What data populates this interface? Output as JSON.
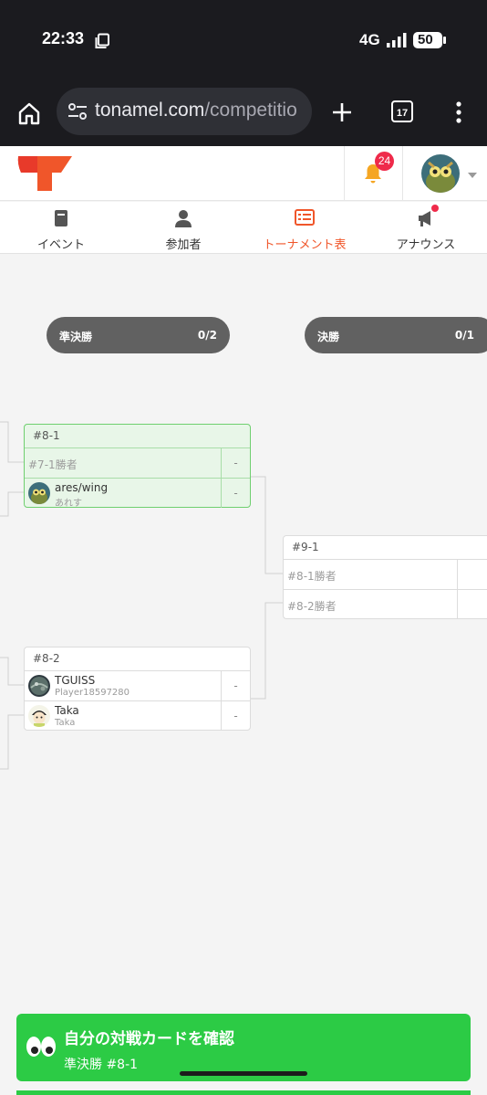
{
  "status_bar": {
    "time": "22:33",
    "network": "4G",
    "battery": "50"
  },
  "browser": {
    "url_host": "tonamel.com",
    "url_path": "/competitio",
    "tab_count": "17"
  },
  "header": {
    "notification_count": "24",
    "accent": "#f0562a"
  },
  "tabs": [
    {
      "label": "イベント",
      "icon": "document-icon"
    },
    {
      "label": "参加者",
      "icon": "person-icon"
    },
    {
      "label": "トーナメント表",
      "icon": "bracket-list-icon",
      "active": true
    },
    {
      "label": "アナウンス",
      "icon": "megaphone-icon"
    }
  ],
  "rounds": [
    {
      "name": "準決勝",
      "progress": "0/2"
    },
    {
      "name": "決勝",
      "progress": "0/1"
    }
  ],
  "matches": {
    "m81": {
      "id": "#8-1",
      "slot1": {
        "label": "#7-1勝者",
        "score": "-"
      },
      "slot2": {
        "name": "ares/wing",
        "sub": "あれす",
        "score": "-"
      }
    },
    "m82": {
      "id": "#8-2",
      "slot1": {
        "name": "TGUISS",
        "sub": "Player18597280",
        "score": "-"
      },
      "slot2": {
        "name": "Taka",
        "sub": "Taka",
        "score": "-"
      }
    },
    "m91": {
      "id": "#9-1",
      "slot1": {
        "label": "#8-1勝者"
      },
      "slot2": {
        "label": "#8-2勝者"
      }
    }
  },
  "my_match_banner": {
    "title": "自分の対戦カードを確認",
    "subtitle": "準決勝 #8-1",
    "color": "#2ccb45"
  }
}
